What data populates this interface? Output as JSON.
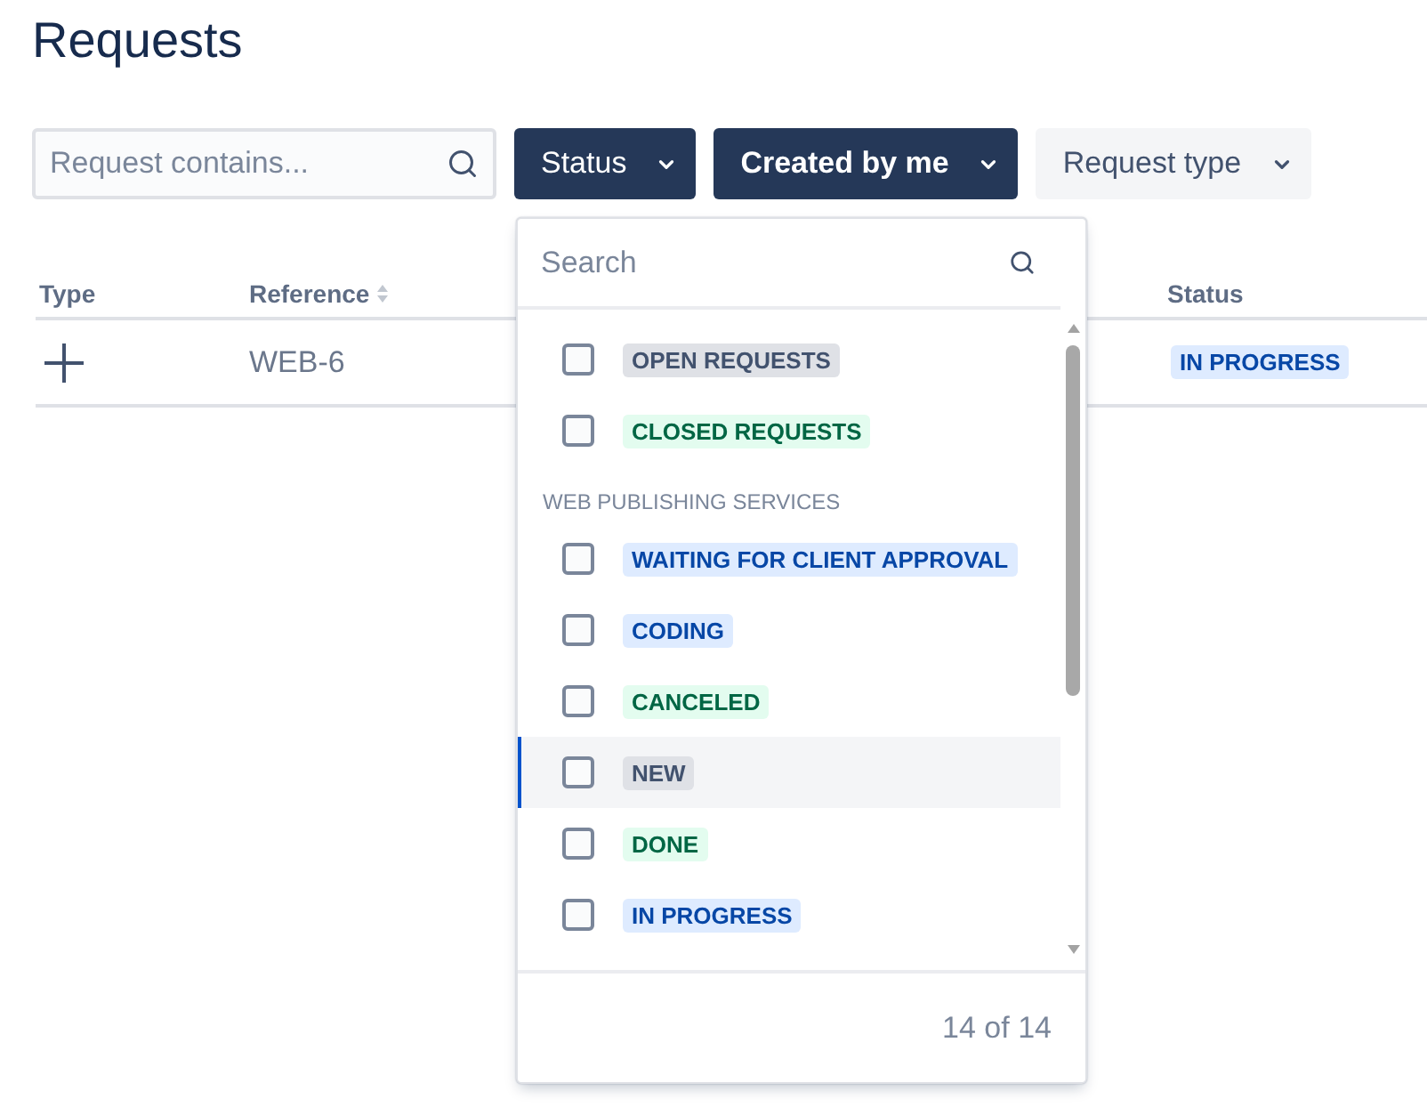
{
  "page": {
    "title": "Requests"
  },
  "toolbar": {
    "search": {
      "placeholder": "Request contains..."
    },
    "filters": [
      {
        "label": "Status",
        "open": true,
        "selected": false
      },
      {
        "label": "Created by me",
        "open": false,
        "selected": true
      },
      {
        "label": "Request type",
        "open": false,
        "selected": false
      }
    ]
  },
  "table": {
    "columns": [
      {
        "label": "Type",
        "sortable": false
      },
      {
        "label": "Reference",
        "sortable": true
      },
      {
        "label": "Status",
        "sortable": false
      }
    ],
    "rows": [
      {
        "reference": "WEB-6",
        "status": {
          "label": "IN PROGRESS",
          "color": "#0747a6"
        }
      }
    ]
  },
  "status_dropdown": {
    "search": {
      "placeholder": "Search"
    },
    "groups": [
      {
        "items": [
          {
            "label": "OPEN REQUESTS",
            "color": "#42526e",
            "checked": false,
            "focused": false
          },
          {
            "label": "CLOSED REQUESTS",
            "color": "#006644",
            "checked": false,
            "focused": false
          }
        ]
      },
      {
        "heading": "WEB PUBLISHING SERVICES",
        "items": [
          {
            "label": "WAITING FOR CLIENT APPROVAL",
            "color": "#0747a6",
            "checked": false,
            "focused": false
          },
          {
            "label": "CODING",
            "color": "#0747a6",
            "checked": false,
            "focused": false
          },
          {
            "label": "CANCELED",
            "color": "#006644",
            "checked": false,
            "focused": false
          },
          {
            "label": "NEW",
            "color": "#42526e",
            "checked": false,
            "focused": true
          },
          {
            "label": "DONE",
            "color": "#006644",
            "checked": false,
            "focused": false
          },
          {
            "label": "IN PROGRESS",
            "color": "#0747a6",
            "checked": false,
            "focused": false
          }
        ]
      }
    ],
    "footer": "14 of 14"
  }
}
